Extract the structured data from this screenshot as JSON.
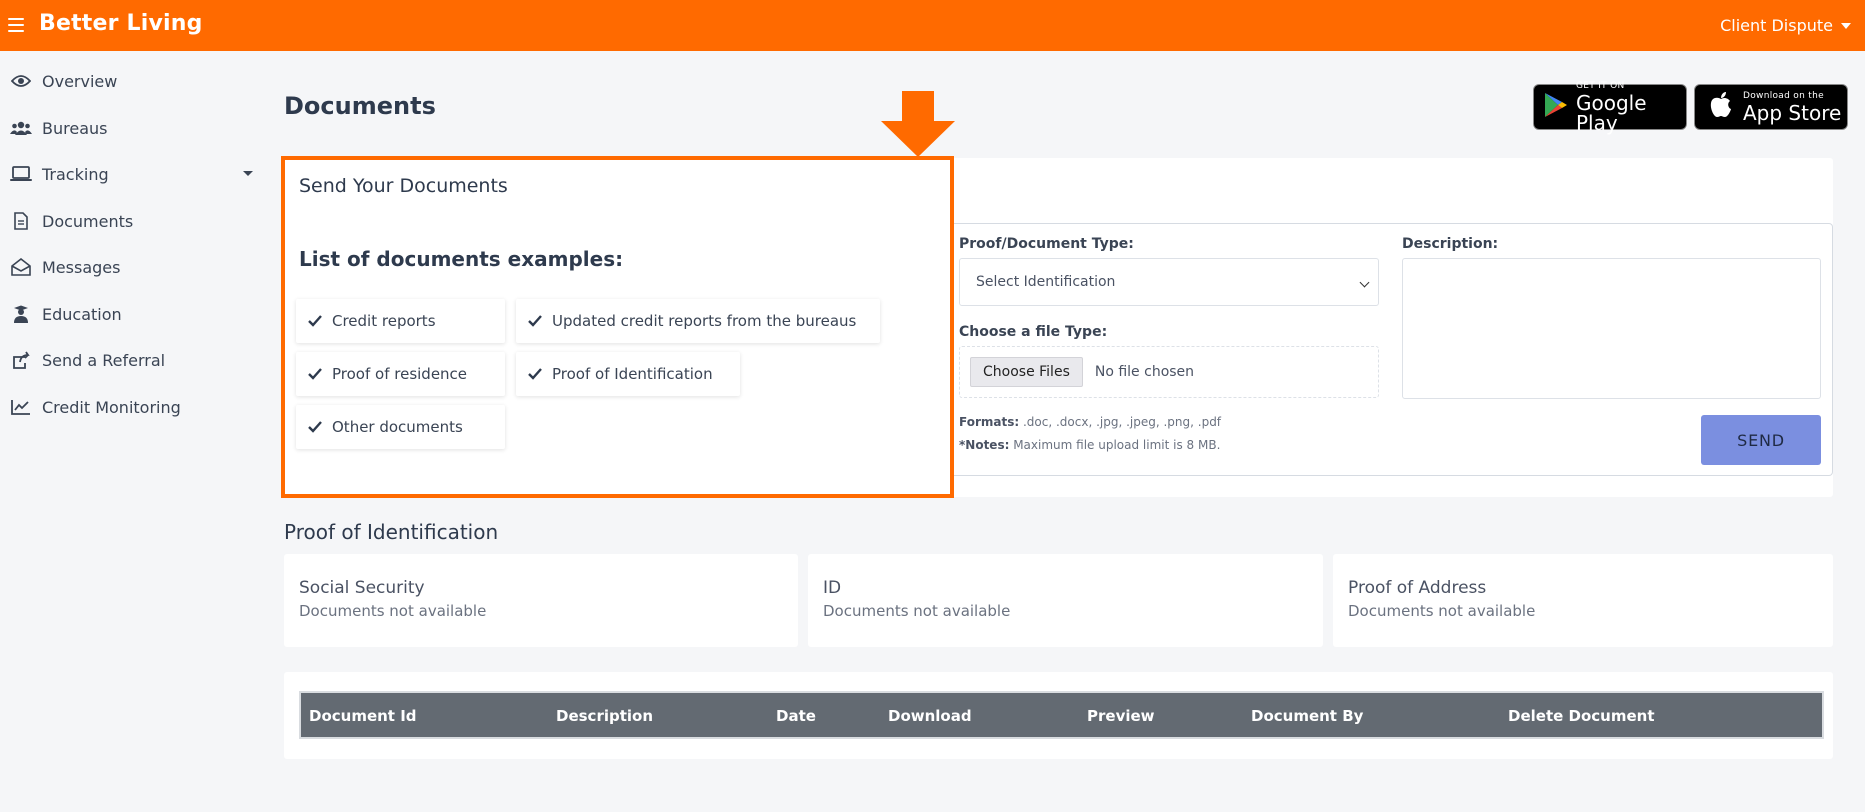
{
  "header": {
    "brand": "Better Living",
    "user_menu": "Client Dispute"
  },
  "sidebar": {
    "items": [
      {
        "label": "Overview",
        "icon": "eye-icon"
      },
      {
        "label": "Bureaus",
        "icon": "users-icon"
      },
      {
        "label": "Tracking",
        "icon": "laptop-icon"
      },
      {
        "label": "Documents",
        "icon": "document-icon"
      },
      {
        "label": "Messages",
        "icon": "envelope-open-icon"
      },
      {
        "label": "Education",
        "icon": "graduate-icon"
      },
      {
        "label": "Send a Referral",
        "icon": "share-icon"
      },
      {
        "label": "Credit Monitoring",
        "icon": "line-chart-icon"
      }
    ]
  },
  "page": {
    "title": "Documents"
  },
  "store_badges": {
    "google_small": "GET IT ON",
    "google_big": "Google Play",
    "apple_small": "Download on the",
    "apple_big": "App Store"
  },
  "send_section": {
    "title": "Send Your Documents",
    "examples_title": "List of documents examples:",
    "examples": [
      "Credit reports",
      "Updated credit reports from the bureaus",
      "Proof of residence",
      "Proof of Identification",
      "Other documents"
    ]
  },
  "form": {
    "doc_type_label": "Proof/Document Type:",
    "doc_type_selected": "Select Identification",
    "file_type_label": "Choose a file Type:",
    "choose_files_label": "Choose Files",
    "no_file_text": "No file chosen",
    "description_label": "Description:",
    "formats_label": "Formats:",
    "formats_value": " .doc, .docx, .jpg, .jpeg, .png, .pdf",
    "notes_label": "*Notes:",
    "notes_value": " Maximum file upload limit is 8 MB.",
    "send_label": "SEND"
  },
  "proof_section": {
    "title": "Proof of Identification",
    "cards": [
      {
        "name": "Social Security",
        "status": "Documents not available"
      },
      {
        "name": "ID",
        "status": "Documents not available"
      },
      {
        "name": "Proof of Address",
        "status": "Documents not available"
      }
    ]
  },
  "table": {
    "columns": [
      "Document Id",
      "Description",
      "Date",
      "Download",
      "Preview",
      "Document By",
      "Delete Document"
    ]
  },
  "colors": {
    "brand_orange": "#ff6a00",
    "send_button": "#7b8fe0",
    "table_header": "#636a72"
  }
}
